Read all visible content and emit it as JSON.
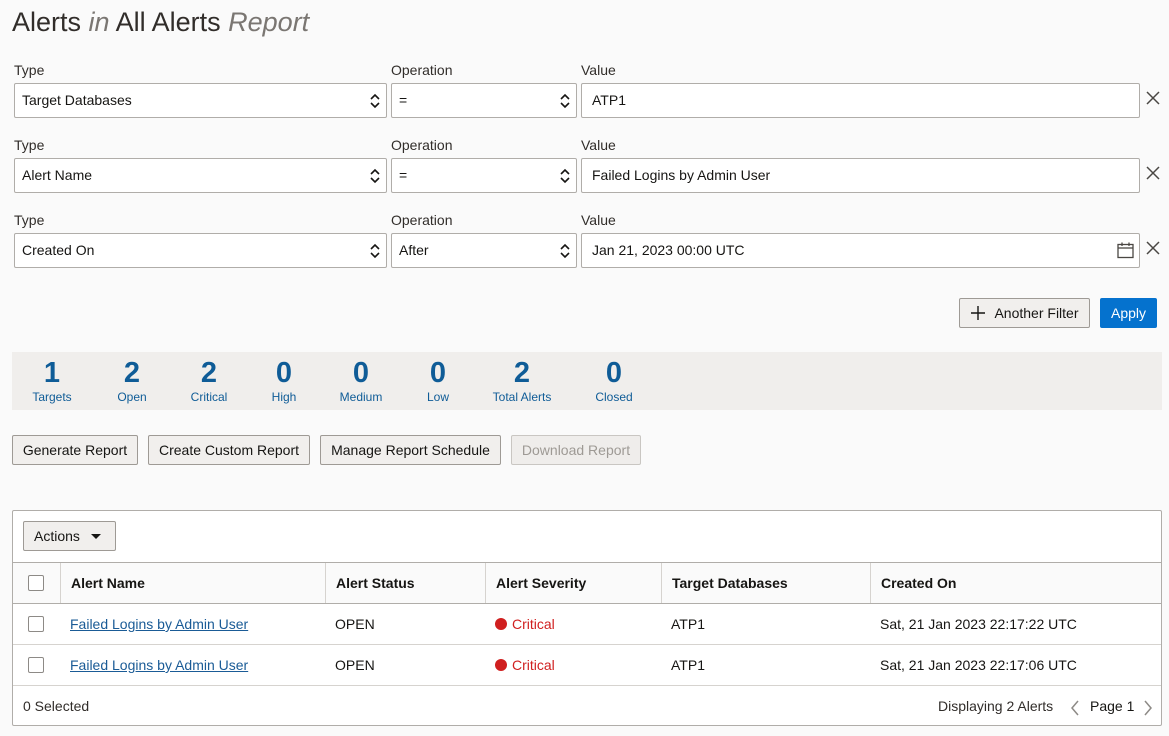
{
  "title": {
    "part1": "Alerts",
    "part2": "in",
    "part3": "All Alerts",
    "part4": "Report"
  },
  "filters": [
    {
      "type_label": "Type",
      "type_value": "Target Databases",
      "op_label": "Operation",
      "op_value": "=",
      "value_label": "Value",
      "value": "ATP1"
    },
    {
      "type_label": "Type",
      "type_value": "Alert Name",
      "op_label": "Operation",
      "op_value": "=",
      "value_label": "Value",
      "value": "Failed Logins by Admin User"
    },
    {
      "type_label": "Type",
      "type_value": "Created On",
      "op_label": "Operation",
      "op_value": "After",
      "value_label": "Value",
      "value": "Jan 21, 2023 00:00 UTC"
    }
  ],
  "filter_buttons": {
    "another": "Another Filter",
    "apply": "Apply"
  },
  "stats": [
    {
      "num": "1",
      "cap": "Targets"
    },
    {
      "num": "2",
      "cap": "Open"
    },
    {
      "num": "2",
      "cap": "Critical"
    },
    {
      "num": "0",
      "cap": "High"
    },
    {
      "num": "0",
      "cap": "Medium"
    },
    {
      "num": "0",
      "cap": "Low"
    },
    {
      "num": "2",
      "cap": "Total Alerts"
    },
    {
      "num": "0",
      "cap": "Closed"
    }
  ],
  "report_buttons": {
    "generate": "Generate Report",
    "custom": "Create Custom Report",
    "schedule": "Manage Report Schedule",
    "download": "Download Report"
  },
  "table": {
    "actions_label": "Actions",
    "columns": [
      "Alert Name",
      "Alert Status",
      "Alert Severity",
      "Target Databases",
      "Created On"
    ],
    "rows": [
      {
        "name": "Failed Logins by Admin User",
        "status": "OPEN",
        "severity": "Critical",
        "target": "ATP1",
        "created": "Sat, 21 Jan 2023 22:17:22 UTC"
      },
      {
        "name": "Failed Logins by Admin User",
        "status": "OPEN",
        "severity": "Critical",
        "target": "ATP1",
        "created": "Sat, 21 Jan 2023 22:17:06 UTC"
      }
    ],
    "selected": "0 Selected",
    "displaying": "Displaying 2 Alerts",
    "page": "Page 1"
  },
  "colors": {
    "accent": "#0572ce",
    "stat_text": "#0f5c97",
    "critical": "#d01f1f",
    "link": "#1a5b96"
  },
  "icons": [
    "chevron-updown-icon",
    "close-icon",
    "calendar-icon",
    "plus-icon",
    "caret-down-icon",
    "chevron-left-icon",
    "chevron-right-icon",
    "status-dot-icon"
  ]
}
